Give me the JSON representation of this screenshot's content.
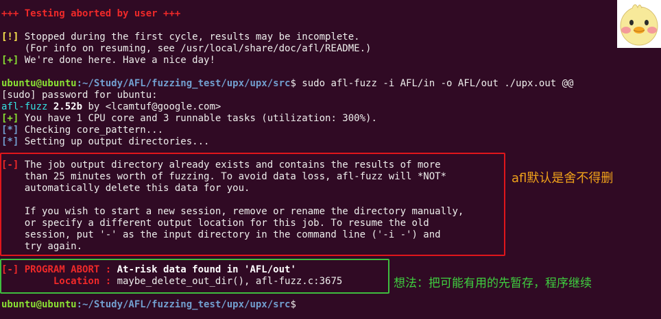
{
  "lines": {
    "aborted": "+++ Testing aborted by user +++",
    "stopped_tag": "[!]",
    "stopped_text": " Stopped during the first cycle, results may be incomplete.",
    "resume_info": "    (For info on resuming, see /usr/local/share/doc/afl/README.)",
    "done_tag": "[+]",
    "done_text": " We're done here. Have a nice day!",
    "prompt_user": "ubuntu@ubuntu",
    "prompt_path": ":~/Study/AFL/fuzzing_test/upx/upx/src",
    "command": "$ sudo afl-fuzz -i AFL/in -o AFL/out ./upx.out @@",
    "sudo_prompt": "[sudo] password for ubuntu:",
    "afl_name": "afl-fuzz",
    "afl_version": " 2.52b",
    "afl_by": " by <lcamtuf@google.com>",
    "cpu_tag": "[+]",
    "cpu_text": " You have 1 CPU core and 3 runnable tasks (utilization: 300%).",
    "core_tag": "[*]",
    "core_text": " Checking core_pattern...",
    "setup_tag": "[*]",
    "setup_text": " Setting up output directories...",
    "err_tag": "[-]",
    "err_l1": " The job output directory already exists and contains the results of more",
    "err_l2": "    than 25 minutes worth of fuzzing. To avoid data loss, afl-fuzz will *NOT*",
    "err_l3": "    automatically delete this data for you.",
    "err_l4": "    If you wish to start a new session, remove or rename the directory manually,",
    "err_l5": "    or specify a different output location for this job. To resume the old",
    "err_l6": "    session, put '-' as the input directory in the command line ('-i -') and",
    "err_l7": "    try again.",
    "abort_tag": "[-]",
    "abort_label": " PROGRAM ABORT : ",
    "abort_msg": "At-risk data found in 'AFL/out'",
    "loc_label": "         Location : ",
    "loc_msg": "maybe_delete_out_dir(), afl-fuzz.c:3675",
    "final_prompt_user": "ubuntu@ubuntu",
    "final_prompt_path": ":~/Study/AFL/fuzzing_test/upx/upx/src",
    "final_prompt_dollar": "$"
  },
  "annotations": {
    "note_red": "afl默认是舍不得删",
    "note_green": "想法：把可能有用的先暂存，程序继续"
  },
  "colors": {
    "background": "#300a24",
    "box_red": "#e0161b",
    "box_green": "#3fbf3f",
    "note_orange": "#f0a21a"
  }
}
